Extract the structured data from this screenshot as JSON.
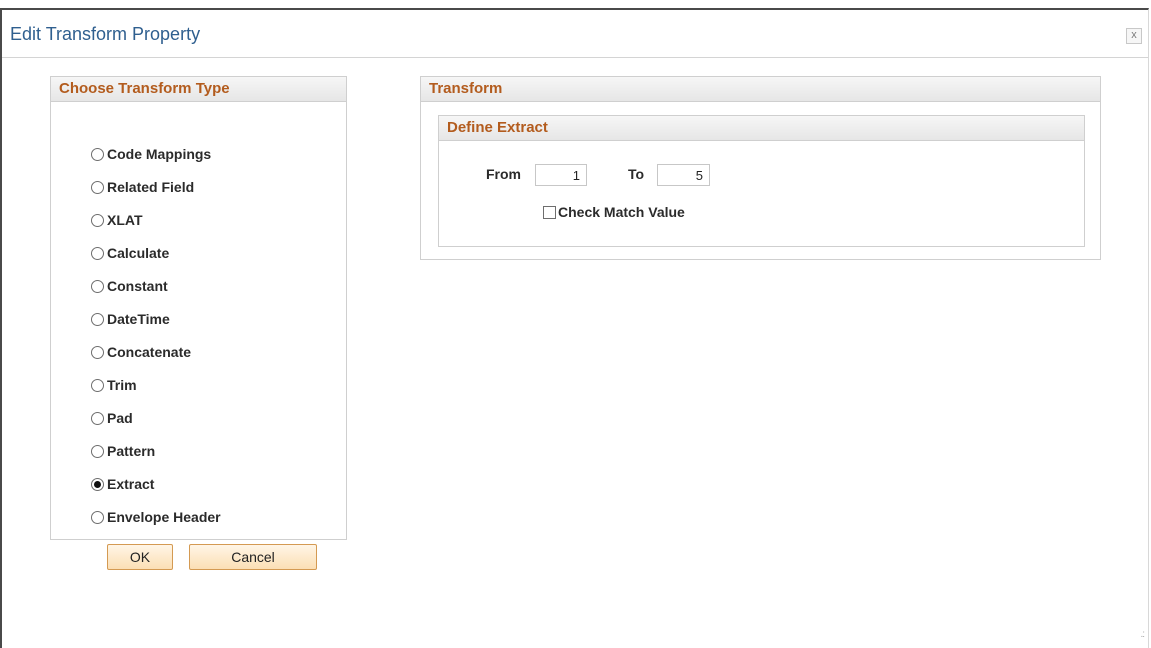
{
  "dialog": {
    "title": "Edit Transform Property",
    "close_label": "x"
  },
  "transform_type": {
    "header": "Choose Transform Type",
    "options": [
      {
        "label": "Code Mappings",
        "selected": false
      },
      {
        "label": "Related Field",
        "selected": false
      },
      {
        "label": "XLAT",
        "selected": false
      },
      {
        "label": "Calculate",
        "selected": false
      },
      {
        "label": "Constant",
        "selected": false
      },
      {
        "label": "DateTime",
        "selected": false
      },
      {
        "label": "Concatenate",
        "selected": false
      },
      {
        "label": "Trim",
        "selected": false
      },
      {
        "label": "Pad",
        "selected": false
      },
      {
        "label": "Pattern",
        "selected": false
      },
      {
        "label": "Extract",
        "selected": true
      },
      {
        "label": "Envelope Header",
        "selected": false
      }
    ]
  },
  "transform": {
    "header": "Transform",
    "define_extract": {
      "header": "Define Extract",
      "from_label": "From",
      "from_value": "1",
      "to_label": "To",
      "to_value": "5",
      "check_match_label": "Check Match Value",
      "check_match_checked": false
    }
  },
  "buttons": {
    "ok_label": "OK",
    "cancel_label": "Cancel"
  },
  "colors": {
    "title": "#2f5f8f",
    "group_header": "#b35c1e",
    "button_border": "#d49a52"
  }
}
